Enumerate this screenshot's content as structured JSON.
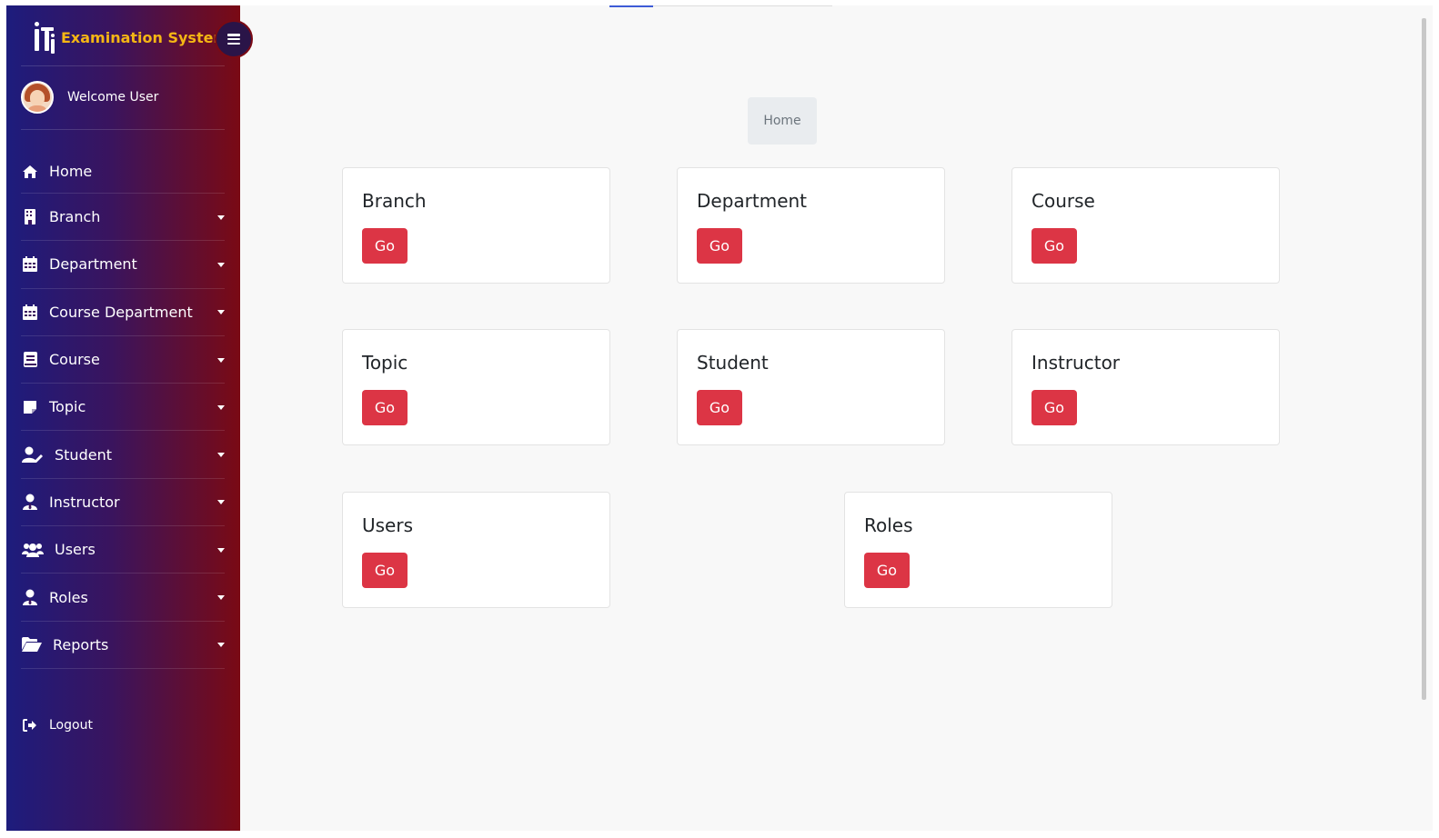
{
  "app": {
    "title": "Examination System"
  },
  "user": {
    "welcome": "Welcome User"
  },
  "sidebar": {
    "items": [
      {
        "label": "Home",
        "icon": "home-icon",
        "has_caret": false
      },
      {
        "label": "Branch",
        "icon": "building-icon",
        "has_caret": true
      },
      {
        "label": "Department",
        "icon": "calendar-icon",
        "has_caret": true
      },
      {
        "label": "Course Department",
        "icon": "calendar-icon",
        "has_caret": true
      },
      {
        "label": "Course",
        "icon": "book-icon",
        "has_caret": true
      },
      {
        "label": "Topic",
        "icon": "note-icon",
        "has_caret": true
      },
      {
        "label": "Student",
        "icon": "user-edit-icon",
        "has_caret": true
      },
      {
        "label": "Instructor",
        "icon": "user-tie-icon",
        "has_caret": true
      },
      {
        "label": "Users",
        "icon": "users-icon",
        "has_caret": true
      },
      {
        "label": "Roles",
        "icon": "user-tie-icon",
        "has_caret": true
      },
      {
        "label": "Reports",
        "icon": "folder-open-icon",
        "has_caret": true
      }
    ],
    "logout": {
      "label": "Logout",
      "icon": "sign-out-icon"
    }
  },
  "breadcrumb": {
    "current": "Home"
  },
  "cards": [
    {
      "title": "Branch",
      "button": "Go"
    },
    {
      "title": "Department",
      "button": "Go"
    },
    {
      "title": "Course",
      "button": "Go"
    },
    {
      "title": "Topic",
      "button": "Go"
    },
    {
      "title": "Student",
      "button": "Go"
    },
    {
      "title": "Instructor",
      "button": "Go"
    },
    {
      "title": "Users",
      "button": "Go"
    },
    {
      "title": "Roles",
      "button": "Go"
    }
  ],
  "colors": {
    "brand_title": "#f5b614",
    "sidebar_gradient_start": "#1d1c7d",
    "sidebar_gradient_end": "#7a0a14",
    "go_button": "#dc3545",
    "breadcrumb_bg": "#e9ecef"
  }
}
